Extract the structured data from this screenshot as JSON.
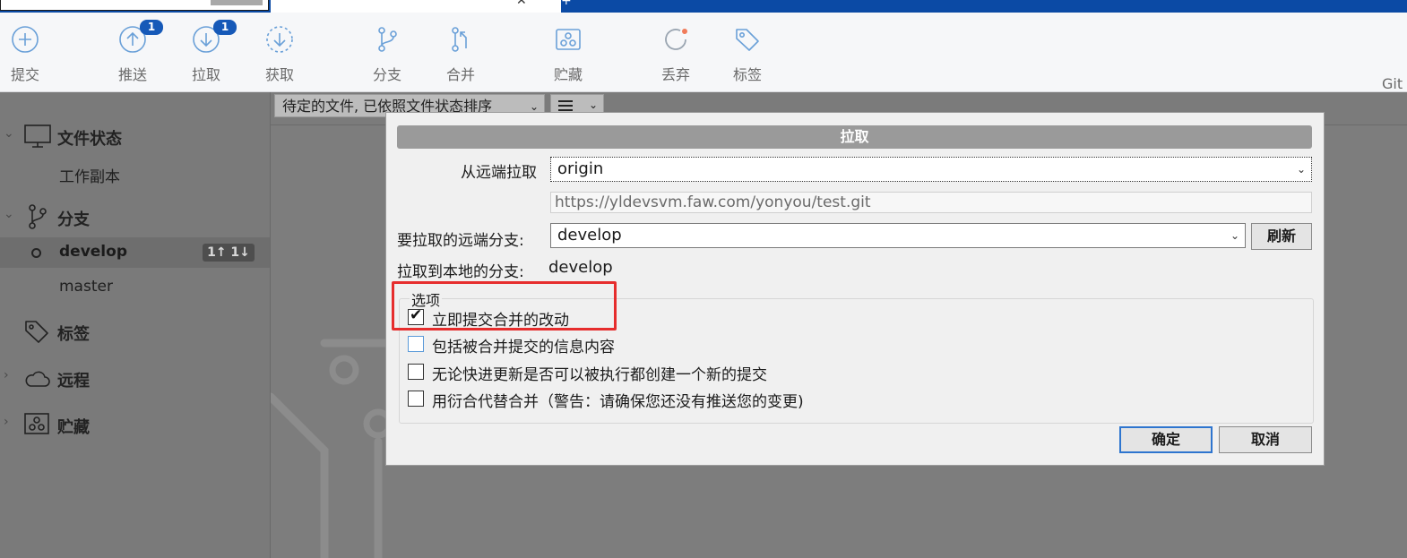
{
  "toolbar": {
    "commit": "提交",
    "push": "推送",
    "push_badge": "1",
    "pull": "拉取",
    "pull_badge": "1",
    "fetch": "获取",
    "branch": "分支",
    "merge": "合并",
    "stash": "贮藏",
    "discard": "丢弃",
    "tag": "标签",
    "git": "Git"
  },
  "sidebar": {
    "file_status": "文件状态",
    "working_copy": "工作副本",
    "branches": "分支",
    "branch_develop": "develop",
    "develop_ahead_behind": "1↑ 1↓",
    "branch_master": "master",
    "tags": "标签",
    "remotes": "远程",
    "stashes": "贮藏"
  },
  "main": {
    "sort_select": "待定的文件, 已依照文件状态排序"
  },
  "dialog": {
    "title": "拉取",
    "remote_label": "从远端拉取",
    "remote_value": "origin",
    "remote_url": "https://yldevsvm.faw.com/yonyou/test.git",
    "remote_branch_label": "要拉取的远端分支:",
    "remote_branch_value": "develop",
    "refresh_button": "刷新",
    "local_branch_label": "拉取到本地的分支:",
    "local_branch_value": "develop",
    "options_legend": "选项",
    "options": [
      {
        "label": "立即提交合并的改动",
        "checked": true
      },
      {
        "label": "包括被合并提交的信息内容",
        "checked": false
      },
      {
        "label": "无论快进更新是否可以被执行都创建一个新的提交",
        "checked": false
      },
      {
        "label": "用衍合代替合并（警告：请确保您还没有推送您的变更)",
        "checked": false
      }
    ],
    "ok_button": "确定",
    "cancel_button": "取消"
  },
  "colors": {
    "accent": "#1659b8",
    "highlight": "#e62d2d",
    "top_strip": "#0b4aa5"
  }
}
